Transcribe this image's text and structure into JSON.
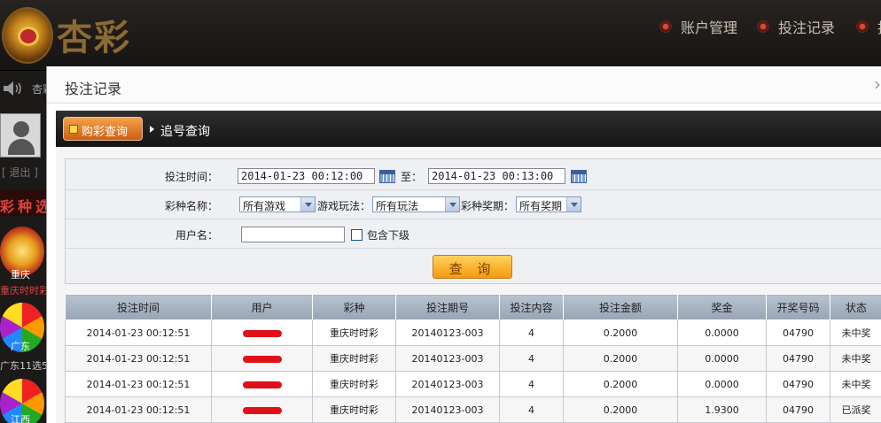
{
  "app": {
    "logo_text": "杏彩",
    "nav": [
      "账户管理",
      "投注记录",
      "投"
    ],
    "notice": "杏彩",
    "logout": "[ 退出 ]",
    "lottery_section": "彩种选",
    "lotteries": [
      {
        "badge": "重庆",
        "caption": "重庆时时彩"
      },
      {
        "badge": "广东",
        "caption": "广东11选5"
      },
      {
        "badge": "江西",
        "caption": ""
      }
    ]
  },
  "modal": {
    "title": "投注记录",
    "close": "›",
    "tabs": {
      "active": "购彩查询",
      "second": "追号查询"
    }
  },
  "filter": {
    "bet_time_label": "投注时间：",
    "start_time": "2014-01-23 00:12:00",
    "to_label": "至：",
    "end_time": "2014-01-23 00:13:00",
    "game_label": "彩种名称：",
    "game_value": "所有游戏",
    "play_label": "游戏玩法：",
    "play_value": "所有玩法",
    "issue_label": "彩种奖期：",
    "issue_value": "所有奖期",
    "user_label": "用户名：",
    "user_value": "",
    "include_sub_label": "包含下级",
    "query_button": "查 询"
  },
  "table": {
    "headers": [
      "投注时间",
      "用户",
      "彩种",
      "投注期号",
      "投注内容",
      "投注金额",
      "奖金",
      "开奖号码",
      "状态"
    ],
    "rows": [
      [
        "2014-01-23 00:12:51",
        "",
        "重庆时时彩",
        "20140123-003",
        "4",
        "0.2000",
        "0.0000",
        "04790",
        "未中奖"
      ],
      [
        "2014-01-23 00:12:51",
        "",
        "重庆时时彩",
        "20140123-003",
        "4",
        "0.2000",
        "0.0000",
        "04790",
        "未中奖"
      ],
      [
        "2014-01-23 00:12:51",
        "",
        "重庆时时彩",
        "20140123-003",
        "4",
        "0.2000",
        "0.0000",
        "04790",
        "未中奖"
      ],
      [
        "2014-01-23 00:12:51",
        "",
        "重庆时时彩",
        "20140123-003",
        "4",
        "0.2000",
        "1.9300",
        "04790",
        "已派奖"
      ]
    ]
  },
  "colors": {
    "accent": "#f39a12",
    "header_bg": "#141414",
    "status_green": "#1a8a1a",
    "redaction": "#e0101a"
  }
}
